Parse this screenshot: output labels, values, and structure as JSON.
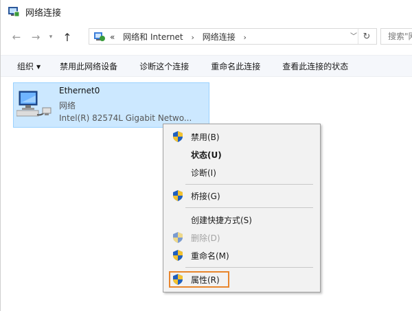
{
  "window": {
    "title": "网络连接"
  },
  "nav": {
    "crumb_prefix": "«",
    "crumbs": [
      "网络和 Internet",
      "网络连接"
    ],
    "crumb_separator": "›",
    "search_placeholder": "搜索\"网"
  },
  "toolbar": {
    "organize": "组织",
    "disable_device": "禁用此网络设备",
    "diagnose": "诊断这个连接",
    "rename": "重命名此连接",
    "view_status": "查看此连接的状态"
  },
  "network": {
    "name": "Ethernet0",
    "type": "网络",
    "device": "Intel(R) 82574L Gigabit Netwo..."
  },
  "menu": {
    "disable": "禁用(B)",
    "status": "状态(U)",
    "diagnose": "诊断(I)",
    "bridge": "桥接(G)",
    "shortcut": "创建快捷方式(S)",
    "delete": "删除(D)",
    "rename": "重命名(M)",
    "properties": "属性(R)"
  },
  "colors": {
    "selection": "#cce8ff",
    "highlight": "#e8852b",
    "shield_blue": "#1f5fbf",
    "shield_yellow": "#f2c230"
  }
}
